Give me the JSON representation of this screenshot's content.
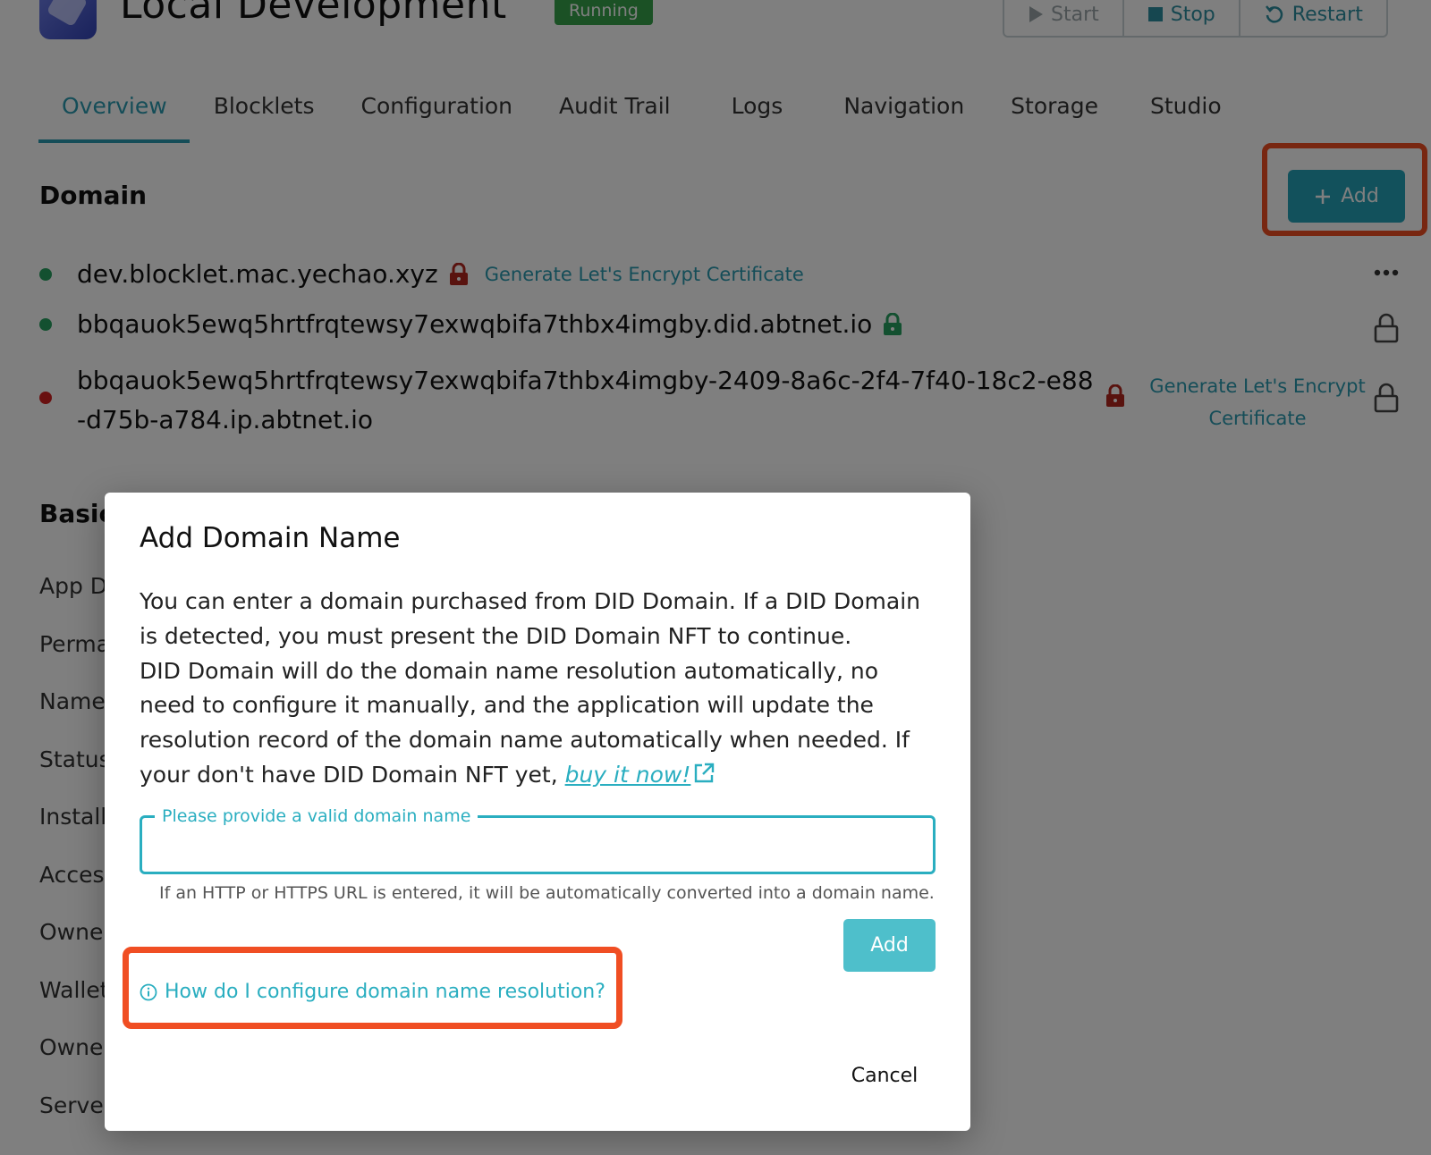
{
  "header": {
    "app_title": "Local Development",
    "status": "Running",
    "actions": {
      "start": "Start",
      "stop": "Stop",
      "restart": "Restart"
    }
  },
  "tabs": [
    "Overview",
    "Blocklets",
    "Configuration",
    "Audit Trail",
    "Logs",
    "Navigation",
    "Storage",
    "Studio"
  ],
  "domain_section": {
    "title": "Domain",
    "add_label": "Add",
    "domains": [
      {
        "name": "dev.blocklet.mac.yechao.xyz",
        "status": "green",
        "cert_link": "Generate Let's Encrypt Certificate"
      },
      {
        "name": "bbqauok5ewq5hrtfrqtewsy7exwqbifa7thbx4imgby.did.abtnet.io",
        "status": "green"
      },
      {
        "name_line1": "bbqauok5ewq5hrtfrqtewsy7exwqbifa7thbx4imgby-2409-8a6c-2f4-7f40-18c2-e88",
        "name_line2": "-d75b-a784.ip.abtnet.io",
        "status": "red",
        "cert_line1": "Generate Let's Encrypt",
        "cert_line2": "Certificate"
      }
    ]
  },
  "basic_section": {
    "title_partial": "Basic",
    "labels": [
      "App D",
      "Perma",
      "Name",
      "Status",
      "Install",
      "Acces",
      "Owne",
      "Wallet",
      "Owne",
      "Serve"
    ]
  },
  "dialog": {
    "title": "Add Domain Name",
    "body_p1": "You can enter a domain purchased from DID Domain. If a DID Domain is detected, you must present the DID Domain NFT to continue.",
    "body_p2": "DID Domain will do the domain name resolution automatically, no need to configure it manually, and the application will update the resolution record of the domain name automatically when needed. If your don't have DID Domain NFT yet,",
    "buy_link": "buy it now!",
    "input_label": "Please provide a valid domain name",
    "input_value": "",
    "helper_text": "If an HTTP or HTTPS URL is entered, it will be automatically converted into a domain name.",
    "add_label": "Add",
    "help_link": "How do I configure domain name resolution?",
    "cancel_label": "Cancel"
  },
  "colors": {
    "accent": "#2aaec0",
    "highlight": "#f04e23",
    "running": "#37a34a"
  }
}
